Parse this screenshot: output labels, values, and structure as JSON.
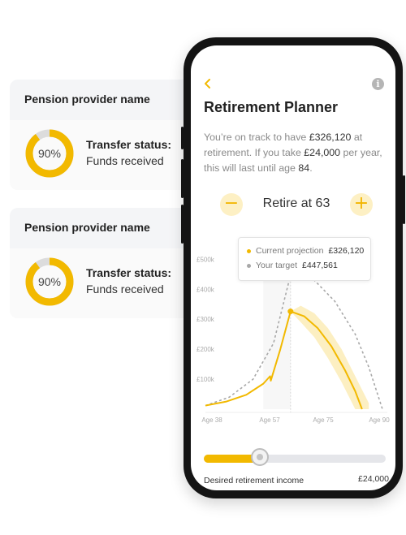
{
  "cards": [
    {
      "provider": "Pension provider name",
      "percent_label": "90%",
      "progress": 0.9,
      "status_label": "Transfer status:",
      "status_value": "Funds received"
    },
    {
      "provider": "Pension provider name",
      "percent_label": "90%",
      "progress": 0.9,
      "status_label": "Transfer status:",
      "status_value": "Funds received"
    }
  ],
  "app": {
    "title": "Retirement Planner",
    "desc_1": "You’re on track to have ",
    "desc_amount": "£326,120",
    "desc_2": " at retirement. If you take ",
    "desc_income": "£24,000",
    "desc_3": " per year, this will last until age ",
    "desc_age": "84",
    "desc_end": ".",
    "retire_label": "Retire at 63",
    "minus_symbol": "−",
    "plus_symbol": "+",
    "info_symbol": "i"
  },
  "tooltip": {
    "current_label": "Current projection",
    "current_value": "£326,120",
    "target_label": "Your target",
    "target_value": "£447,561"
  },
  "slider": {
    "label": "Desired retirement income",
    "value": "£24,000",
    "fraction": 0.31
  },
  "colors": {
    "accent": "#f2b900",
    "target": "#a8a8a8",
    "card_bg": "#f4f5f7",
    "ring_track": "#dcdcdc"
  },
  "chart_data": {
    "type": "line",
    "x_tick_labels": [
      "Age 38",
      "Age 57",
      "Age 75",
      "Age 90"
    ],
    "y_tick_labels": [
      "£100k",
      "£200k",
      "£300k",
      "£400k",
      "£500k"
    ],
    "ylim": [
      0,
      520000
    ],
    "xlim": [
      38,
      90
    ],
    "retire_age": 63,
    "series": [
      {
        "name": "Current projection",
        "points": [
          [
            38,
            12000
          ],
          [
            44,
            25000
          ],
          [
            50,
            48000
          ],
          [
            55,
            85000
          ],
          [
            57,
            110000
          ],
          [
            57.2,
            95000
          ],
          [
            60,
            200000
          ],
          [
            63,
            326120
          ],
          [
            67,
            310000
          ],
          [
            71,
            270000
          ],
          [
            75,
            210000
          ],
          [
            79,
            130000
          ],
          [
            82,
            60000
          ],
          [
            84,
            0
          ]
        ],
        "band": [
          [
            63,
            326120,
            326120
          ],
          [
            66,
            345000,
            290000
          ],
          [
            70,
            320000,
            240000
          ],
          [
            74,
            270000,
            170000
          ],
          [
            78,
            200000,
            90000
          ],
          [
            82,
            110000,
            0
          ],
          [
            86,
            20000,
            0
          ]
        ]
      },
      {
        "name": "Your target",
        "points": [
          [
            38,
            12000
          ],
          [
            45,
            40000
          ],
          [
            52,
            100000
          ],
          [
            58,
            220000
          ],
          [
            63,
            447561
          ],
          [
            70,
            430000
          ],
          [
            76,
            360000
          ],
          [
            82,
            250000
          ],
          [
            86,
            140000
          ],
          [
            90,
            0
          ]
        ]
      }
    ],
    "grid": false
  }
}
